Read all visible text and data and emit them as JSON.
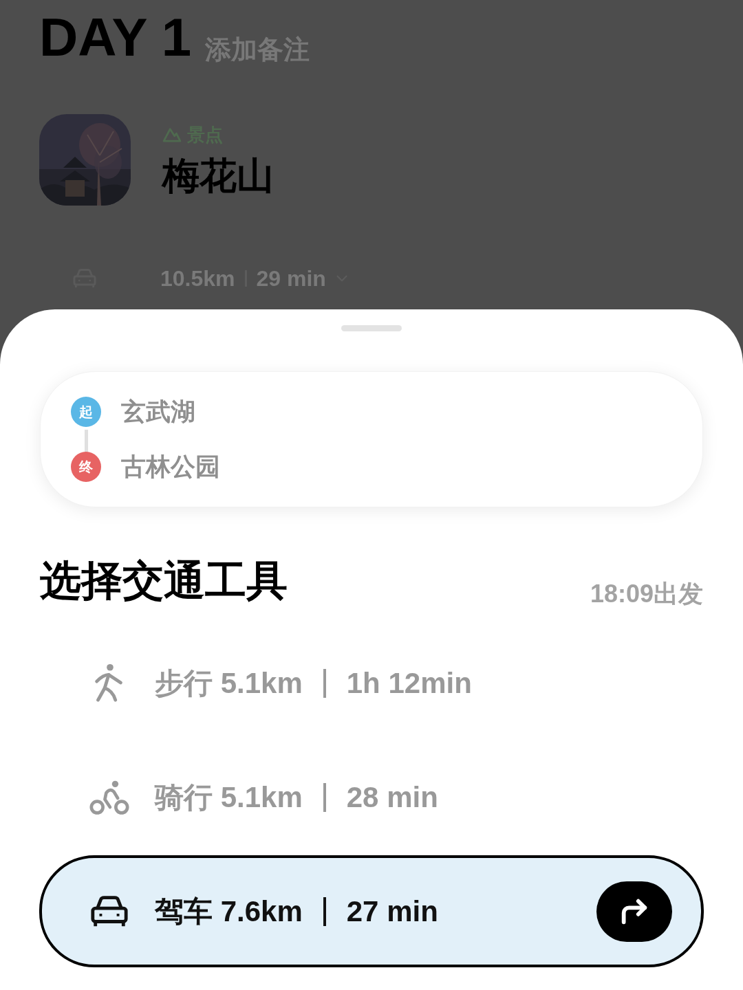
{
  "day": {
    "title": "DAY 1",
    "note": "添加备注"
  },
  "place": {
    "category": "景点",
    "name": "梅花山"
  },
  "leg": {
    "kind": "car",
    "distance": "10.5km",
    "duration": "29 min"
  },
  "route": {
    "start_badge": "起",
    "start": "玄武湖",
    "end_badge": "终",
    "end": "古林公园"
  },
  "section": {
    "title": "选择交通工具",
    "departure": "18:09出发"
  },
  "modes": [
    {
      "kind": "walk",
      "label": "步行 5.1km",
      "duration": "1h 12min",
      "selected": false
    },
    {
      "kind": "bike",
      "label": "骑行 5.1km",
      "duration": "28 min",
      "selected": false
    },
    {
      "kind": "car",
      "label": "驾车 7.6km",
      "duration": "27 min",
      "selected": true
    }
  ]
}
